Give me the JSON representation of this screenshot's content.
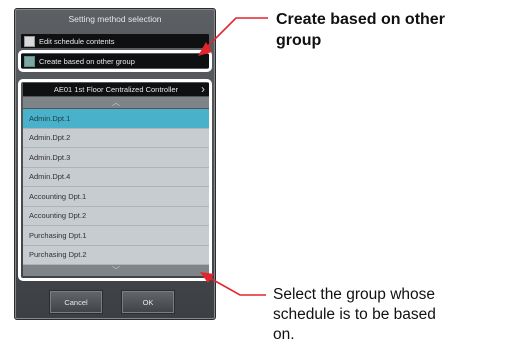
{
  "dialog": {
    "title": "Setting method selection",
    "options": [
      {
        "label": "Edit schedule contents"
      },
      {
        "label": "Create based on other group"
      }
    ],
    "group_header": "AE01 1st Floor Centralized Controller",
    "list_items": [
      "Admin.Dpt.1",
      "Admin.Dpt.2",
      "Admin.Dpt.3",
      "Admin.Dpt.4",
      "Accounting Dpt.1",
      "Accounting Dpt.2",
      "Purchasing Dpt.1",
      "Purchasing Dpt.2"
    ],
    "cancel_label": "Cancel",
    "ok_label": "OK"
  },
  "annotations": {
    "top_line1": "Create based on other",
    "top_line2": "group",
    "bottom_line1": "Select the group whose",
    "bottom_line2": "schedule is to be based",
    "bottom_line3": "on."
  },
  "colors": {
    "arrow": "#e3242b",
    "selected_row": "#49b1c9",
    "dialog_bg": "#4a4d52"
  },
  "icons": [
    "scroll-up-icon",
    "scroll-down-icon",
    "chevron-right-icon",
    "arrow-icon"
  ]
}
